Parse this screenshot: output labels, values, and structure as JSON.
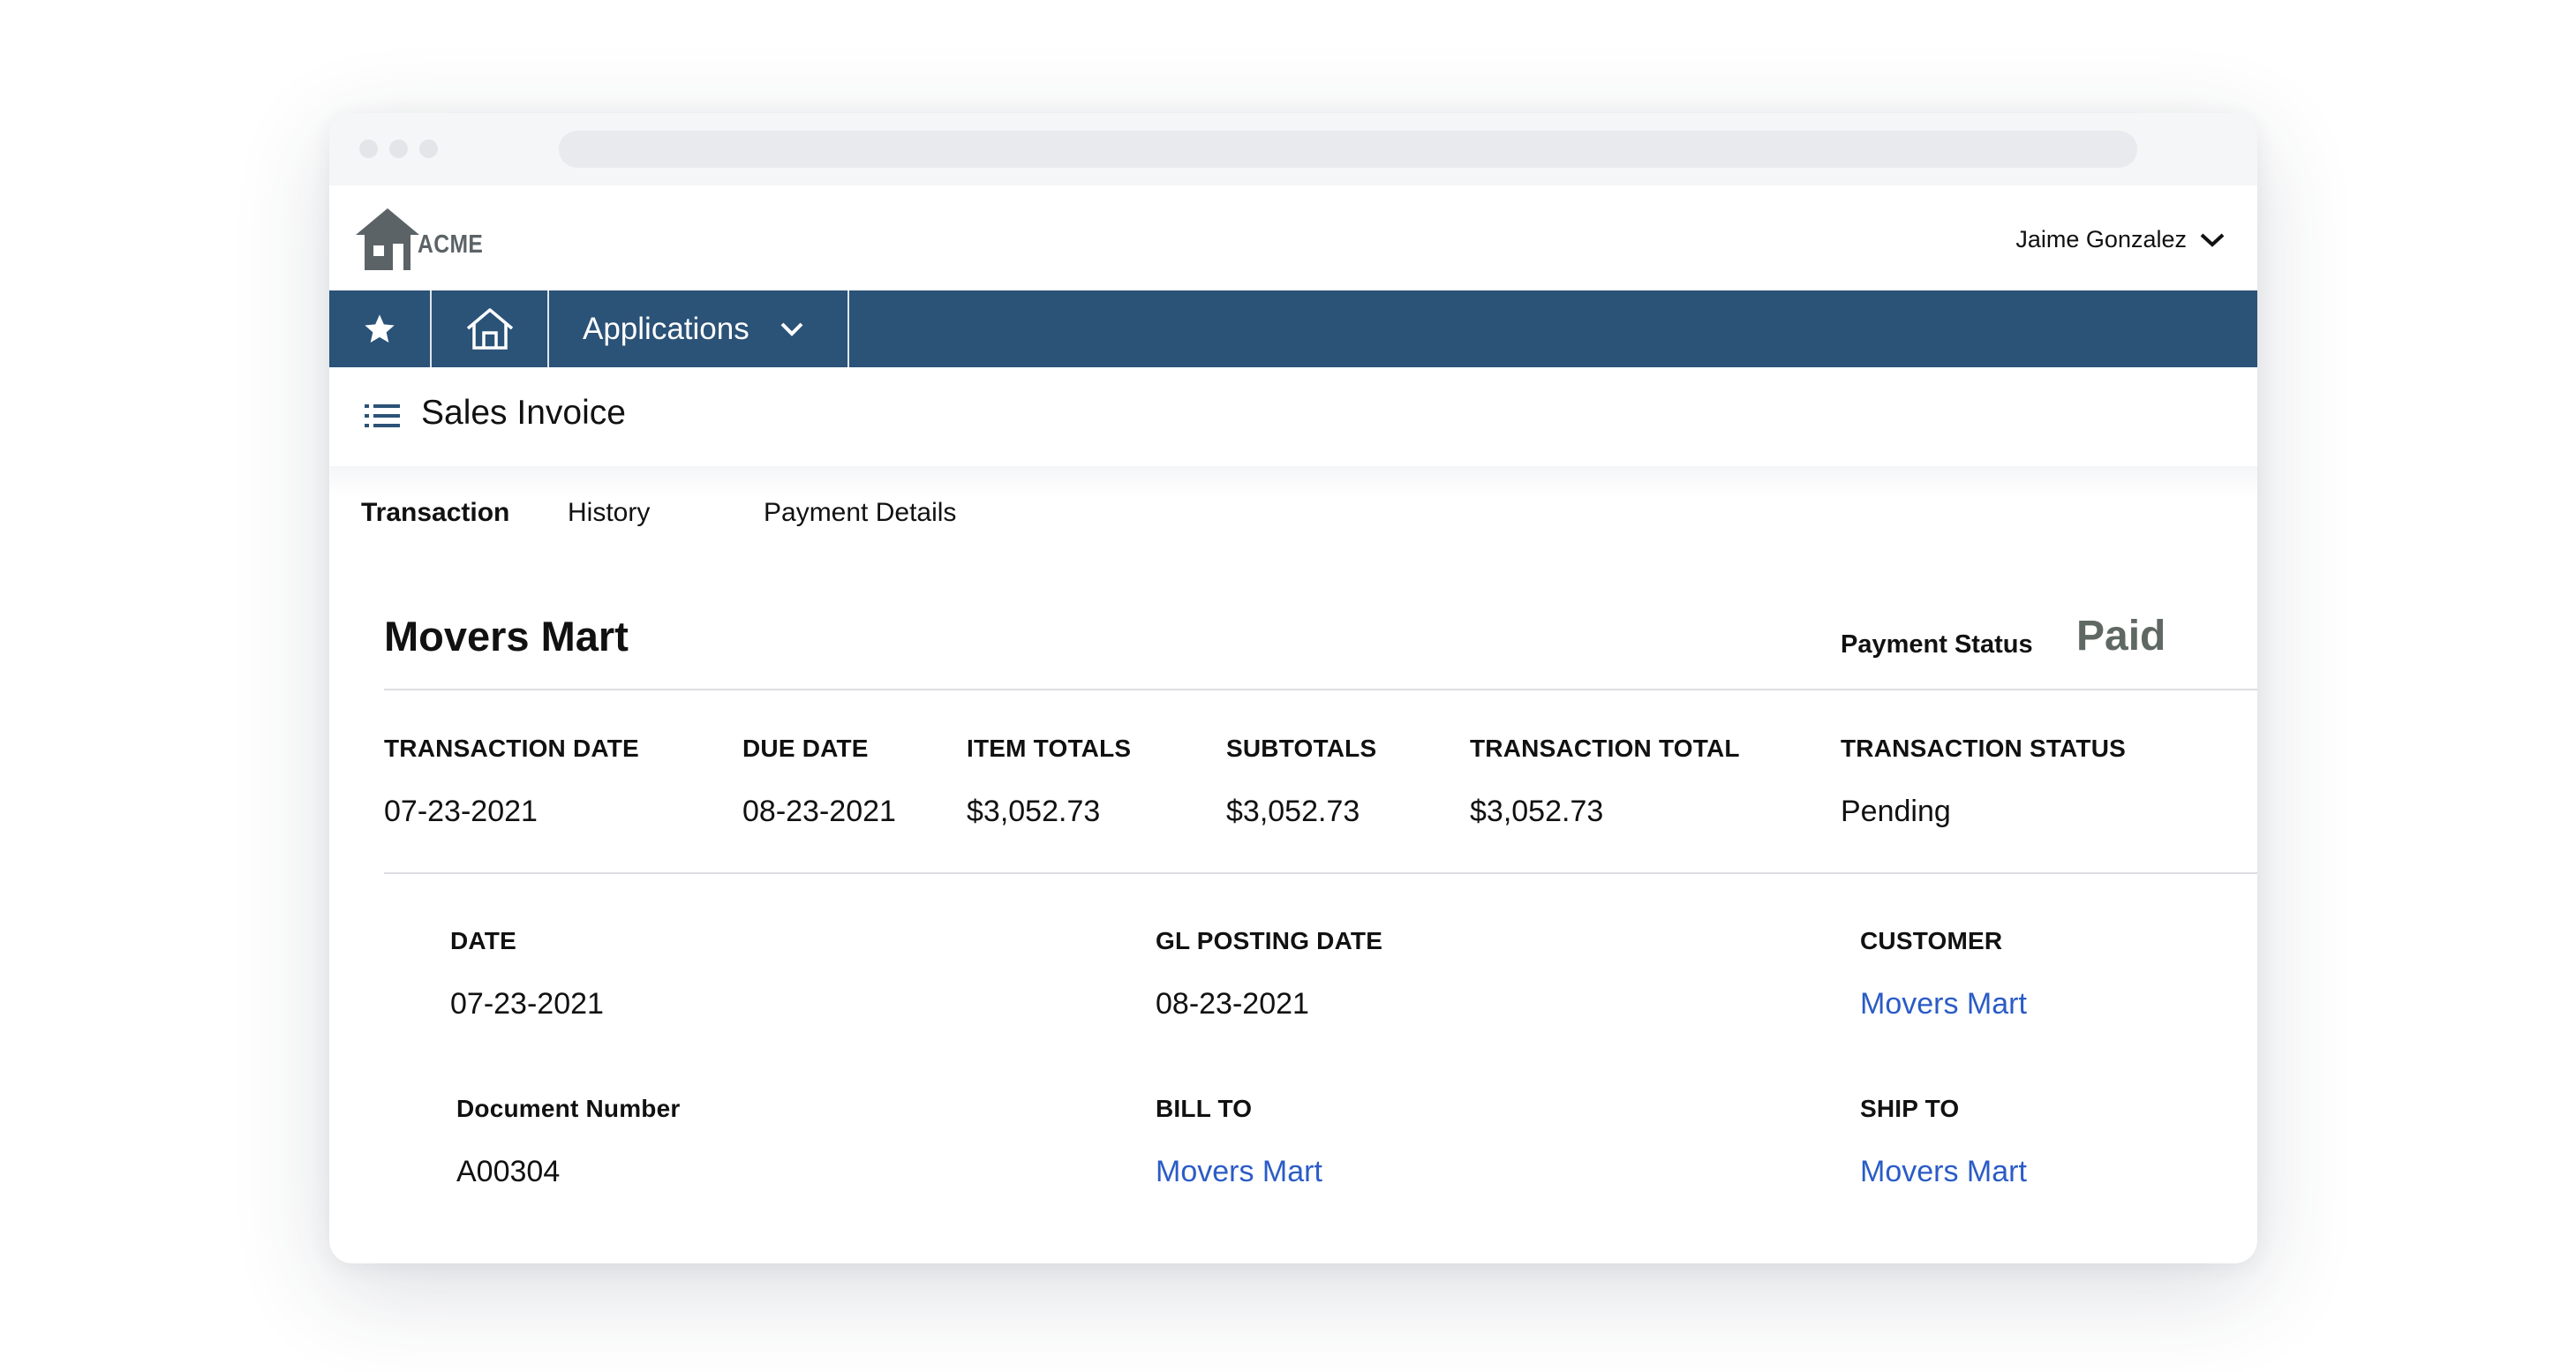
{
  "header": {
    "logo_text": "ACME",
    "user_name": "Jaime Gonzalez",
    "brand_color": "#2b5277"
  },
  "navbar": {
    "favorites_icon": "star-icon",
    "home_icon": "home-icon",
    "applications_label": "Applications"
  },
  "page": {
    "title": "Sales Invoice",
    "tabs": [
      {
        "label": "Transaction",
        "active": true
      },
      {
        "label": "History",
        "active": false
      },
      {
        "label": "Payment Details",
        "active": false
      }
    ]
  },
  "invoice": {
    "customer_name": "Movers Mart",
    "payment_status_label": "Payment Status",
    "payment_status": "Paid",
    "summary": [
      {
        "label": "TRANSACTION DATE",
        "value": "07-23-2021"
      },
      {
        "label": "DUE DATE",
        "value": "08-23-2021"
      },
      {
        "label": "ITEM TOTALS",
        "value": "$3,052.73"
      },
      {
        "label": "SUBTOTALS",
        "value": "$3,052.73"
      },
      {
        "label": "TRANSACTION TOTAL",
        "value": "$3,052.73"
      },
      {
        "label": "TRANSACTION STATUS",
        "value": "Pending"
      }
    ],
    "details": {
      "date": {
        "label": "DATE",
        "value": "07-23-2021"
      },
      "gl_posting_date": {
        "label": "GL POSTING DATE",
        "value": "08-23-2021"
      },
      "customer": {
        "label": "CUSTOMER",
        "value": "Movers Mart"
      },
      "document_number": {
        "label": "Document Number",
        "value": "A00304"
      },
      "bill_to": {
        "label": "BILL TO",
        "value": "Movers Mart"
      },
      "ship_to": {
        "label": "SHIP TO",
        "value": "Movers Mart"
      }
    }
  }
}
